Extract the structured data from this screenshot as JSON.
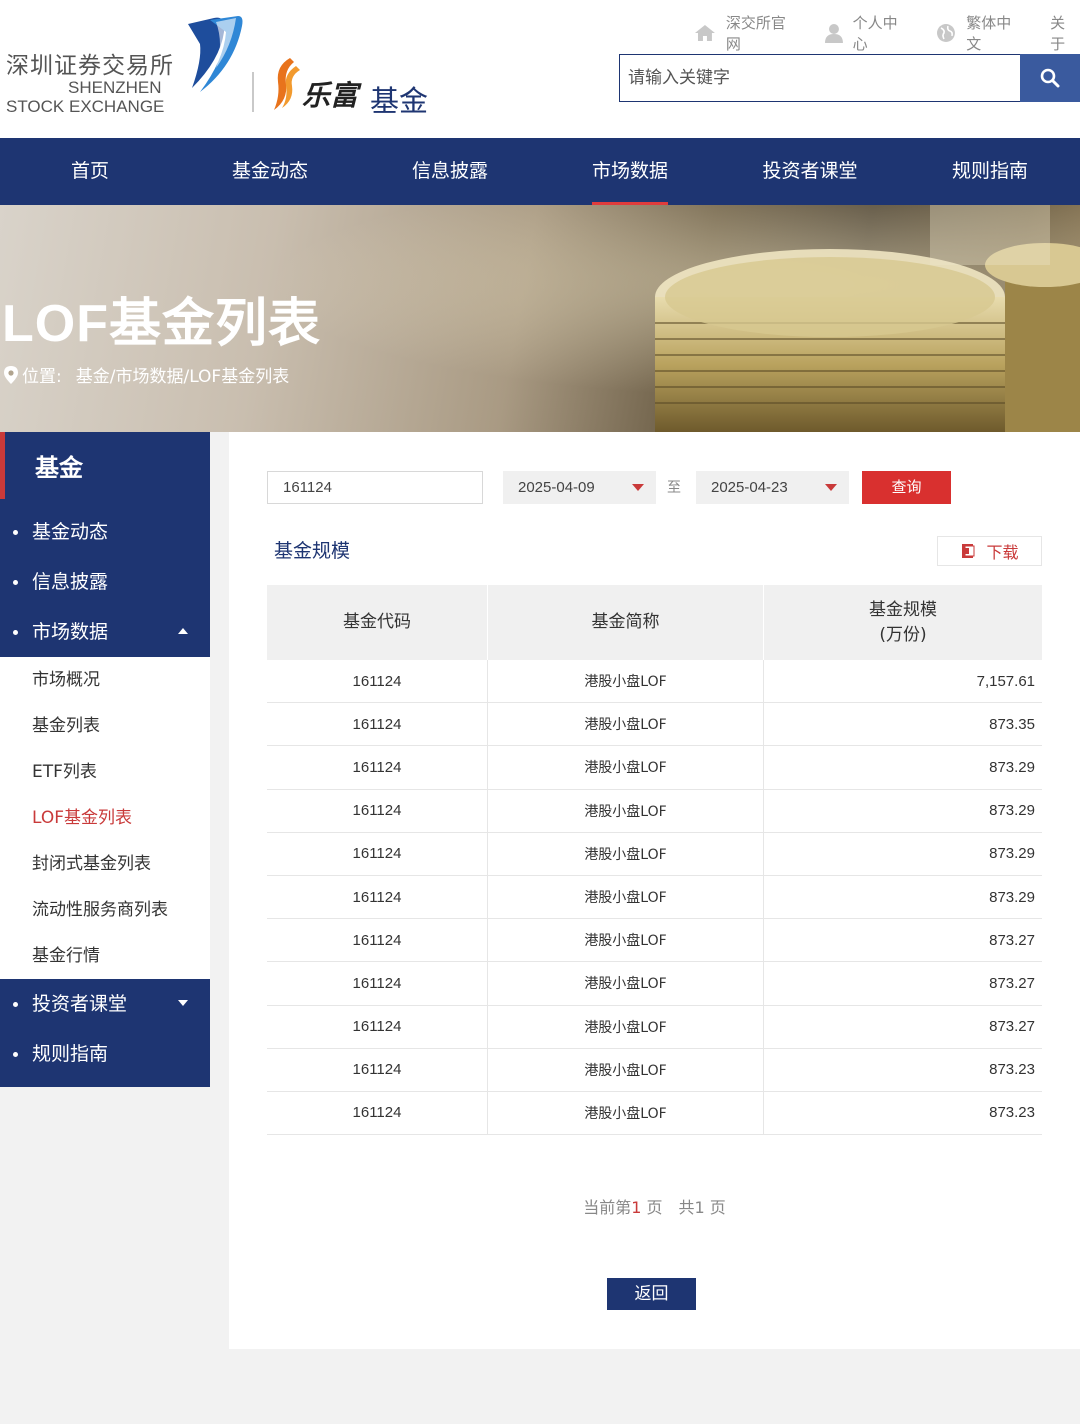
{
  "header": {
    "szse_name_cn": "深圳证券交易所",
    "szse_name_en_line1": "SHENZHEN",
    "szse_name_en_line2": "STOCK EXCHANGE",
    "brand": "乐富",
    "section": "基金",
    "top_links": [
      "深交所官网",
      "个人中心",
      "繁体中文",
      "关于"
    ],
    "search_placeholder": "请输入关键字"
  },
  "nav": {
    "items": [
      "首页",
      "基金动态",
      "信息披露",
      "市场数据",
      "投资者课堂",
      "规则指南"
    ],
    "active": "市场数据"
  },
  "banner": {
    "title": "LOF基金列表",
    "breadcrumb_label": "位置:",
    "breadcrumb_path": "基金/市场数据/LOF基金列表"
  },
  "sidebar": {
    "title": "基金",
    "items": [
      "基金动态",
      "信息披露",
      "市场数据"
    ],
    "subitems": [
      "市场概况",
      "基金列表",
      "ETF列表",
      "LOF基金列表",
      "封闭式基金列表",
      "流动性服务商列表",
      "基金行情"
    ],
    "active_subitem": "LOF基金列表",
    "bottom_items": [
      "投资者课堂",
      "规则指南"
    ]
  },
  "filter": {
    "fund_code": "161124",
    "start_date": "2025-04-09",
    "to_label": "至",
    "end_date": "2025-04-23",
    "query_label": "查询"
  },
  "section": {
    "title": "基金规模",
    "download_label": "下载"
  },
  "table": {
    "headers": [
      "基金代码",
      "基金简称",
      "基金规模\n(万份)"
    ],
    "rows": [
      [
        "161124",
        "港股小盘LOF",
        "7,157.61"
      ],
      [
        "161124",
        "港股小盘LOF",
        "873.35"
      ],
      [
        "161124",
        "港股小盘LOF",
        "873.29"
      ],
      [
        "161124",
        "港股小盘LOF",
        "873.29"
      ],
      [
        "161124",
        "港股小盘LOF",
        "873.29"
      ],
      [
        "161124",
        "港股小盘LOF",
        "873.29"
      ],
      [
        "161124",
        "港股小盘LOF",
        "873.27"
      ],
      [
        "161124",
        "港股小盘LOF",
        "873.27"
      ],
      [
        "161124",
        "港股小盘LOF",
        "873.27"
      ],
      [
        "161124",
        "港股小盘LOF",
        "873.23"
      ],
      [
        "161124",
        "港股小盘LOF",
        "873.23"
      ]
    ]
  },
  "pager": {
    "prefix": "当前第",
    "current": "1",
    "mid": "页　共",
    "total": "1",
    "suffix": "页"
  },
  "back_label": "返回",
  "colors": {
    "primary": "#1e3572",
    "accent": "#d9302f",
    "search_button": "#3a5a9e"
  }
}
